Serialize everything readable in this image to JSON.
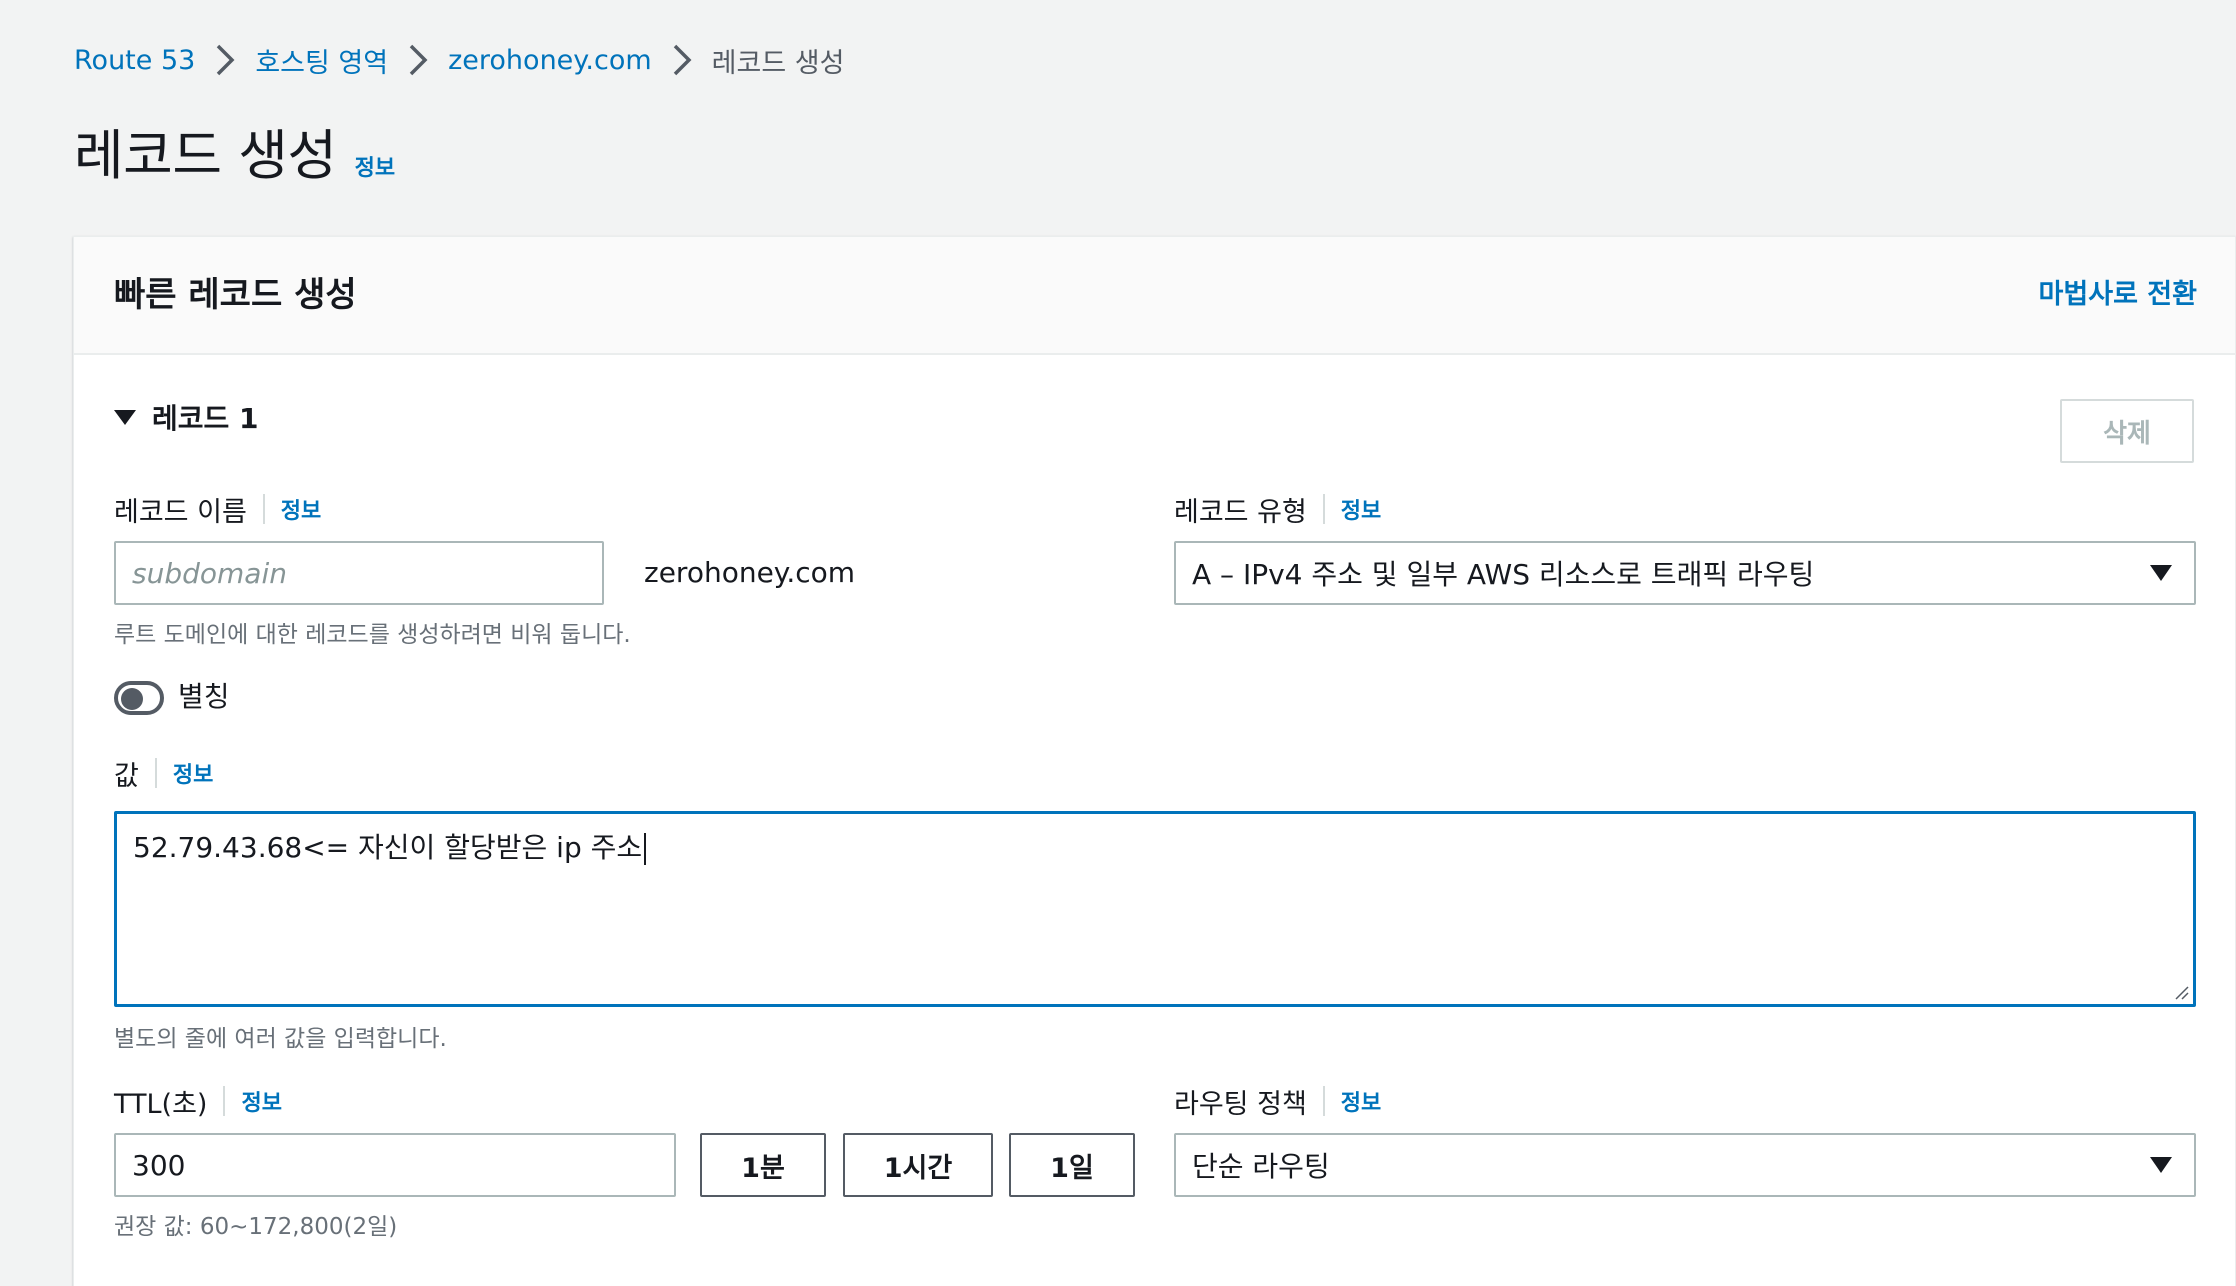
{
  "breadcrumb": {
    "items": [
      "Route 53",
      "호스팅 영역",
      "zerohoney.com"
    ],
    "current": "레코드 생성"
  },
  "page": {
    "title": "레코드 생성",
    "info": "정보"
  },
  "panel": {
    "title": "빠른 레코드 생성",
    "wizard_link": "마법사로 전환",
    "record_title": "레코드 1",
    "delete_button": "삭제"
  },
  "record_name": {
    "label": "레코드 이름",
    "info": "정보",
    "placeholder": "subdomain",
    "domain_suffix": "zerohoney.com",
    "hint": "루트 도메인에 대한 레코드를 생성하려면 비워 둡니다."
  },
  "record_type": {
    "label": "레코드 유형",
    "info": "정보",
    "selected": "A – IPv4 주소 및 일부 AWS 리소스로 트래픽 라우팅"
  },
  "alias": {
    "label": "별칭",
    "enabled": false
  },
  "value": {
    "label": "값",
    "info": "정보",
    "text": "52.79.43.68<= 자신이 할당받은 ip 주소",
    "hint": "별도의 줄에 여러 값을 입력합니다."
  },
  "ttl": {
    "label": "TTL(초)",
    "info": "정보",
    "value": "300",
    "buttons": [
      "1분",
      "1시간",
      "1일"
    ],
    "hint": "권장 값: 60~172,800(2일)"
  },
  "routing_policy": {
    "label": "라우팅 정책",
    "info": "정보",
    "selected": "단순 라우팅"
  },
  "colors": {
    "link": "#0073bb",
    "focus": "#0073bb",
    "background": "#f2f3f3"
  }
}
